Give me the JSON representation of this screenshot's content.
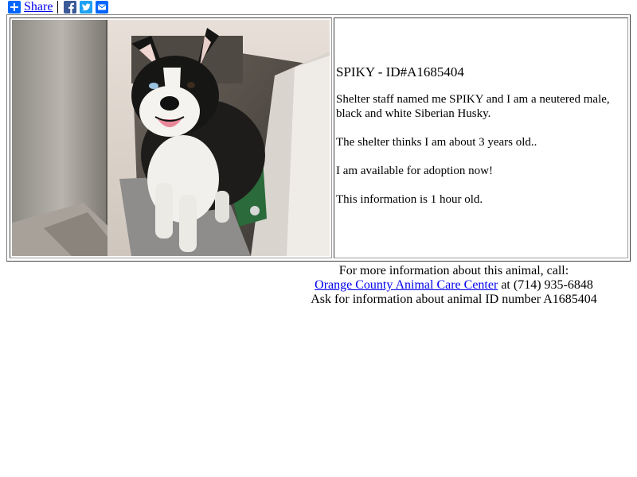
{
  "share_bar": {
    "share_label": "Share",
    "icons": [
      "plus-icon",
      "facebook-icon",
      "twitter-icon",
      "email-icon"
    ]
  },
  "animal": {
    "title": "SPIKY - ID#A1685404",
    "paragraphs": [
      "Shelter staff named me SPIKY and I am a neutered male, black and white Siberian Husky.",
      "The shelter thinks I am about 3 years old..",
      "I am available for adoption now!",
      "This information is 1 hour old."
    ]
  },
  "contact": {
    "intro": "For more information about this animal, call:",
    "shelter_name": "Orange County Animal Care Center",
    "phone_text": " at (714) 935-6848",
    "ask_line": "Ask for information about animal ID number A1685404"
  },
  "colors": {
    "link": "#0000ee",
    "share_blue": "#0166ff",
    "facebook": "#3b5998",
    "twitter": "#1da1f2"
  }
}
